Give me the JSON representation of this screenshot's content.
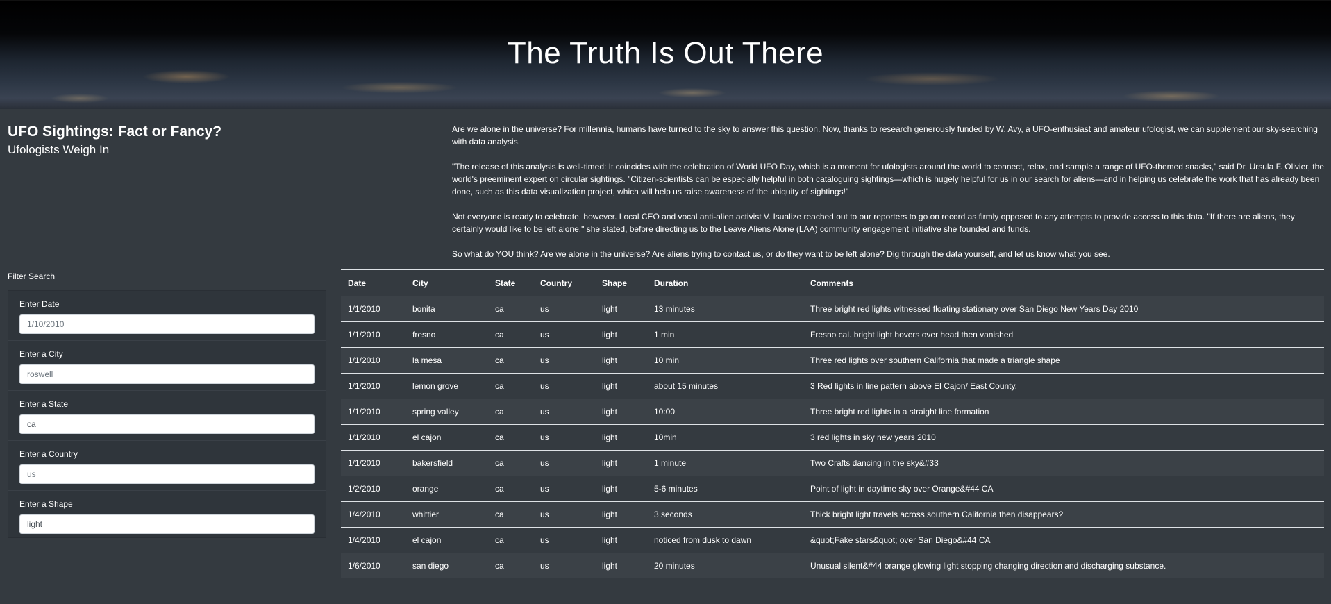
{
  "header": {
    "title": "The Truth Is Out There"
  },
  "article": {
    "title": "UFO Sightings: Fact or Fancy?",
    "subtitle": "Ufologists Weigh In",
    "paragraphs": [
      "Are we alone in the universe? For millennia, humans have turned to the sky to answer this question. Now, thanks to research generously funded by W. Avy, a UFO-enthusiast and amateur ufologist, we can supplement our sky-searching with data analysis.",
      "\"The release of this analysis is well-timed: It coincides with the celebration of World UFO Day, which is a moment for ufologists around the world to connect, relax, and sample a range of UFO-themed snacks,\" said Dr. Ursula F. Olivier, the world's preeminent expert on circular sightings. \"Citizen-scientists can be especially helpful in both cataloguing sightings—which is hugely helpful for us in our search for aliens—and in helping us celebrate the work that has already been done, such as this data visualization project, which will help us raise awareness of the ubiquity of sightings!\"",
      "Not everyone is ready to celebrate, however. Local CEO and vocal anti-alien activist V. Isualize reached out to our reporters to go on record as firmly opposed to any attempts to provide access to this data. \"If there are aliens, they certainly would like to be left alone,\" she stated, before directing us to the Leave Aliens Alone (LAA) community engagement initiative she founded and funds.",
      "So what do YOU think? Are we alone in the universe? Are aliens trying to contact us, or do they want to be left alone? Dig through the data yourself, and let us know what you see."
    ]
  },
  "filters": {
    "title": "Filter Search",
    "items": [
      {
        "label": "Enter Date",
        "placeholder": "1/10/2010"
      },
      {
        "label": "Enter a City",
        "placeholder": "roswell"
      },
      {
        "label": "Enter a State",
        "value": "ca"
      },
      {
        "label": "Enter a Country",
        "placeholder": "us"
      },
      {
        "label": "Enter a Shape",
        "value": "light"
      }
    ]
  },
  "table": {
    "headers": [
      "Date",
      "City",
      "State",
      "Country",
      "Shape",
      "Duration",
      "Comments"
    ],
    "rows": [
      [
        "1/1/2010",
        "bonita",
        "ca",
        "us",
        "light",
        "13 minutes",
        "Three bright red lights witnessed floating stationary over San Diego New Years Day 2010"
      ],
      [
        "1/1/2010",
        "fresno",
        "ca",
        "us",
        "light",
        "1 min",
        "Fresno cal. bright light hovers over head then vanished"
      ],
      [
        "1/1/2010",
        "la mesa",
        "ca",
        "us",
        "light",
        "10 min",
        "Three red lights over southern California that made a triangle shape"
      ],
      [
        "1/1/2010",
        "lemon grove",
        "ca",
        "us",
        "light",
        "about 15 minutes",
        "3 Red lights in line pattern above El Cajon/ East County."
      ],
      [
        "1/1/2010",
        "spring valley",
        "ca",
        "us",
        "light",
        "10:00",
        "Three bright red lights in a straight line formation"
      ],
      [
        "1/1/2010",
        "el cajon",
        "ca",
        "us",
        "light",
        "10min",
        "3 red lights in sky new years 2010"
      ],
      [
        "1/1/2010",
        "bakersfield",
        "ca",
        "us",
        "light",
        "1 minute",
        "Two Crafts dancing in the sky&#33"
      ],
      [
        "1/2/2010",
        "orange",
        "ca",
        "us",
        "light",
        "5-6 minutes",
        "Point of light in daytime sky over Orange&#44 CA"
      ],
      [
        "1/4/2010",
        "whittier",
        "ca",
        "us",
        "light",
        "3 seconds",
        "Thick bright light travels across southern California then disappears?"
      ],
      [
        "1/4/2010",
        "el cajon",
        "ca",
        "us",
        "light",
        "noticed from dusk to dawn",
        "&quot;Fake stars&quot; over San Diego&#44 CA"
      ],
      [
        "1/6/2010",
        "san diego",
        "ca",
        "us",
        "light",
        "20 minutes",
        "Unusual silent&#44 orange glowing light stopping changing direction and discharging substance."
      ]
    ]
  }
}
